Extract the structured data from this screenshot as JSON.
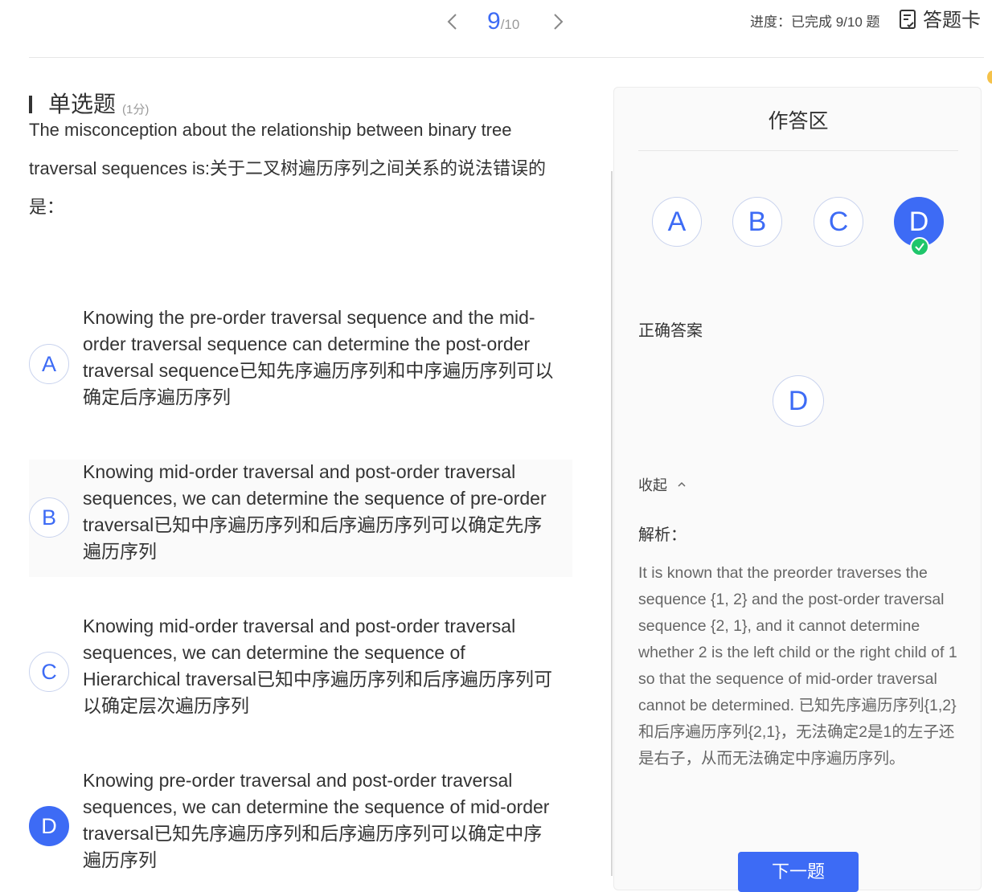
{
  "header": {
    "current_page": "9",
    "total_pages": "/10",
    "progress_text": "进度：已完成 9/10 题",
    "answer_card_label": "答题卡"
  },
  "question": {
    "type_label": "单选题",
    "score": "(1分)",
    "stem": "The misconception about the relationship between binary tree traversal sequences is:关于二叉树遍历序列之间关系的说法错误的是：",
    "options": [
      {
        "letter": "A",
        "text": "Knowing the pre-order traversal sequence and the mid-order traversal sequence can determine the post-order traversal sequence已知先序遍历序列和中序遍历序列可以确定后序遍历序列"
      },
      {
        "letter": "B",
        "text": "Knowing mid-order traversal and post-order traversal sequences, we can determine the sequence of pre-order traversal已知中序遍历序列和后序遍历序列可以确定先序遍历序列"
      },
      {
        "letter": "C",
        "text": "Knowing mid-order traversal and post-order traversal sequences, we can determine the sequence of Hierarchical traversal已知中序遍历序列和后序遍历序列可以确定层次遍历序列"
      },
      {
        "letter": "D",
        "text": "Knowing pre-order traversal and post-order traversal sequences, we can determine the sequence of mid-order traversal已知先序遍历序列和后序遍历序列可以确定中序遍历序列"
      }
    ],
    "selected": "D"
  },
  "panel": {
    "title": "作答区",
    "answers": [
      "A",
      "B",
      "C",
      "D"
    ],
    "correct_label": "正确答案",
    "correct_answer": "D",
    "collapse_label": "收起",
    "analysis_label": "解析：",
    "analysis_text": "It is known that the preorder traverses the sequence {1, 2} and the post-order traversal sequence {2, 1}, and it cannot determine whether 2 is the left child or the right child of 1 so that the sequence of mid-order traversal cannot be determined. 已知先序遍历序列{1,2}和后序遍历序列{2,1}，无法确定2是1的左子还是右子，从而无法确定中序遍历序列。",
    "next_label": "下一题"
  },
  "colors": {
    "accent": "#3d6bf5",
    "check": "#1fc66b"
  }
}
